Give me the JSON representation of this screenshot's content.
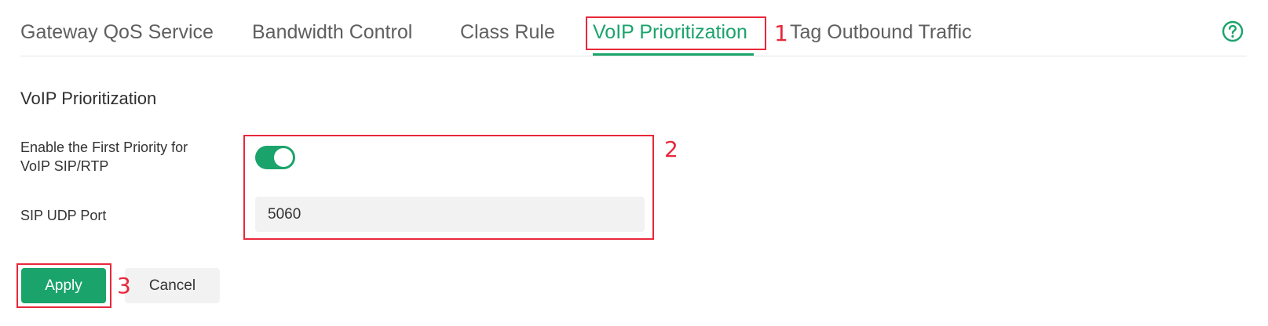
{
  "tabs": [
    {
      "label": "Gateway QoS Service",
      "active": false
    },
    {
      "label": "Bandwidth Control",
      "active": false
    },
    {
      "label": "Class Rule",
      "active": false
    },
    {
      "label": "VoIP Prioritization",
      "active": true
    },
    {
      "label": "Tag Outbound Traffic",
      "active": false
    }
  ],
  "help": {
    "icon": "help-circle-icon"
  },
  "section": {
    "title": "VoIP Prioritization",
    "priority_label_line1": "Enable the First Priority for",
    "priority_label_line2": "VoIP SIP/RTP",
    "priority_enabled": true,
    "port_label": "SIP UDP Port",
    "port_value": "5060"
  },
  "buttons": {
    "apply": "Apply",
    "cancel": "Cancel"
  },
  "annotations": {
    "n1": "1",
    "n2": "2",
    "n3": "3"
  },
  "colors": {
    "accent": "#1ba36c",
    "annotation": "#e8283a"
  }
}
